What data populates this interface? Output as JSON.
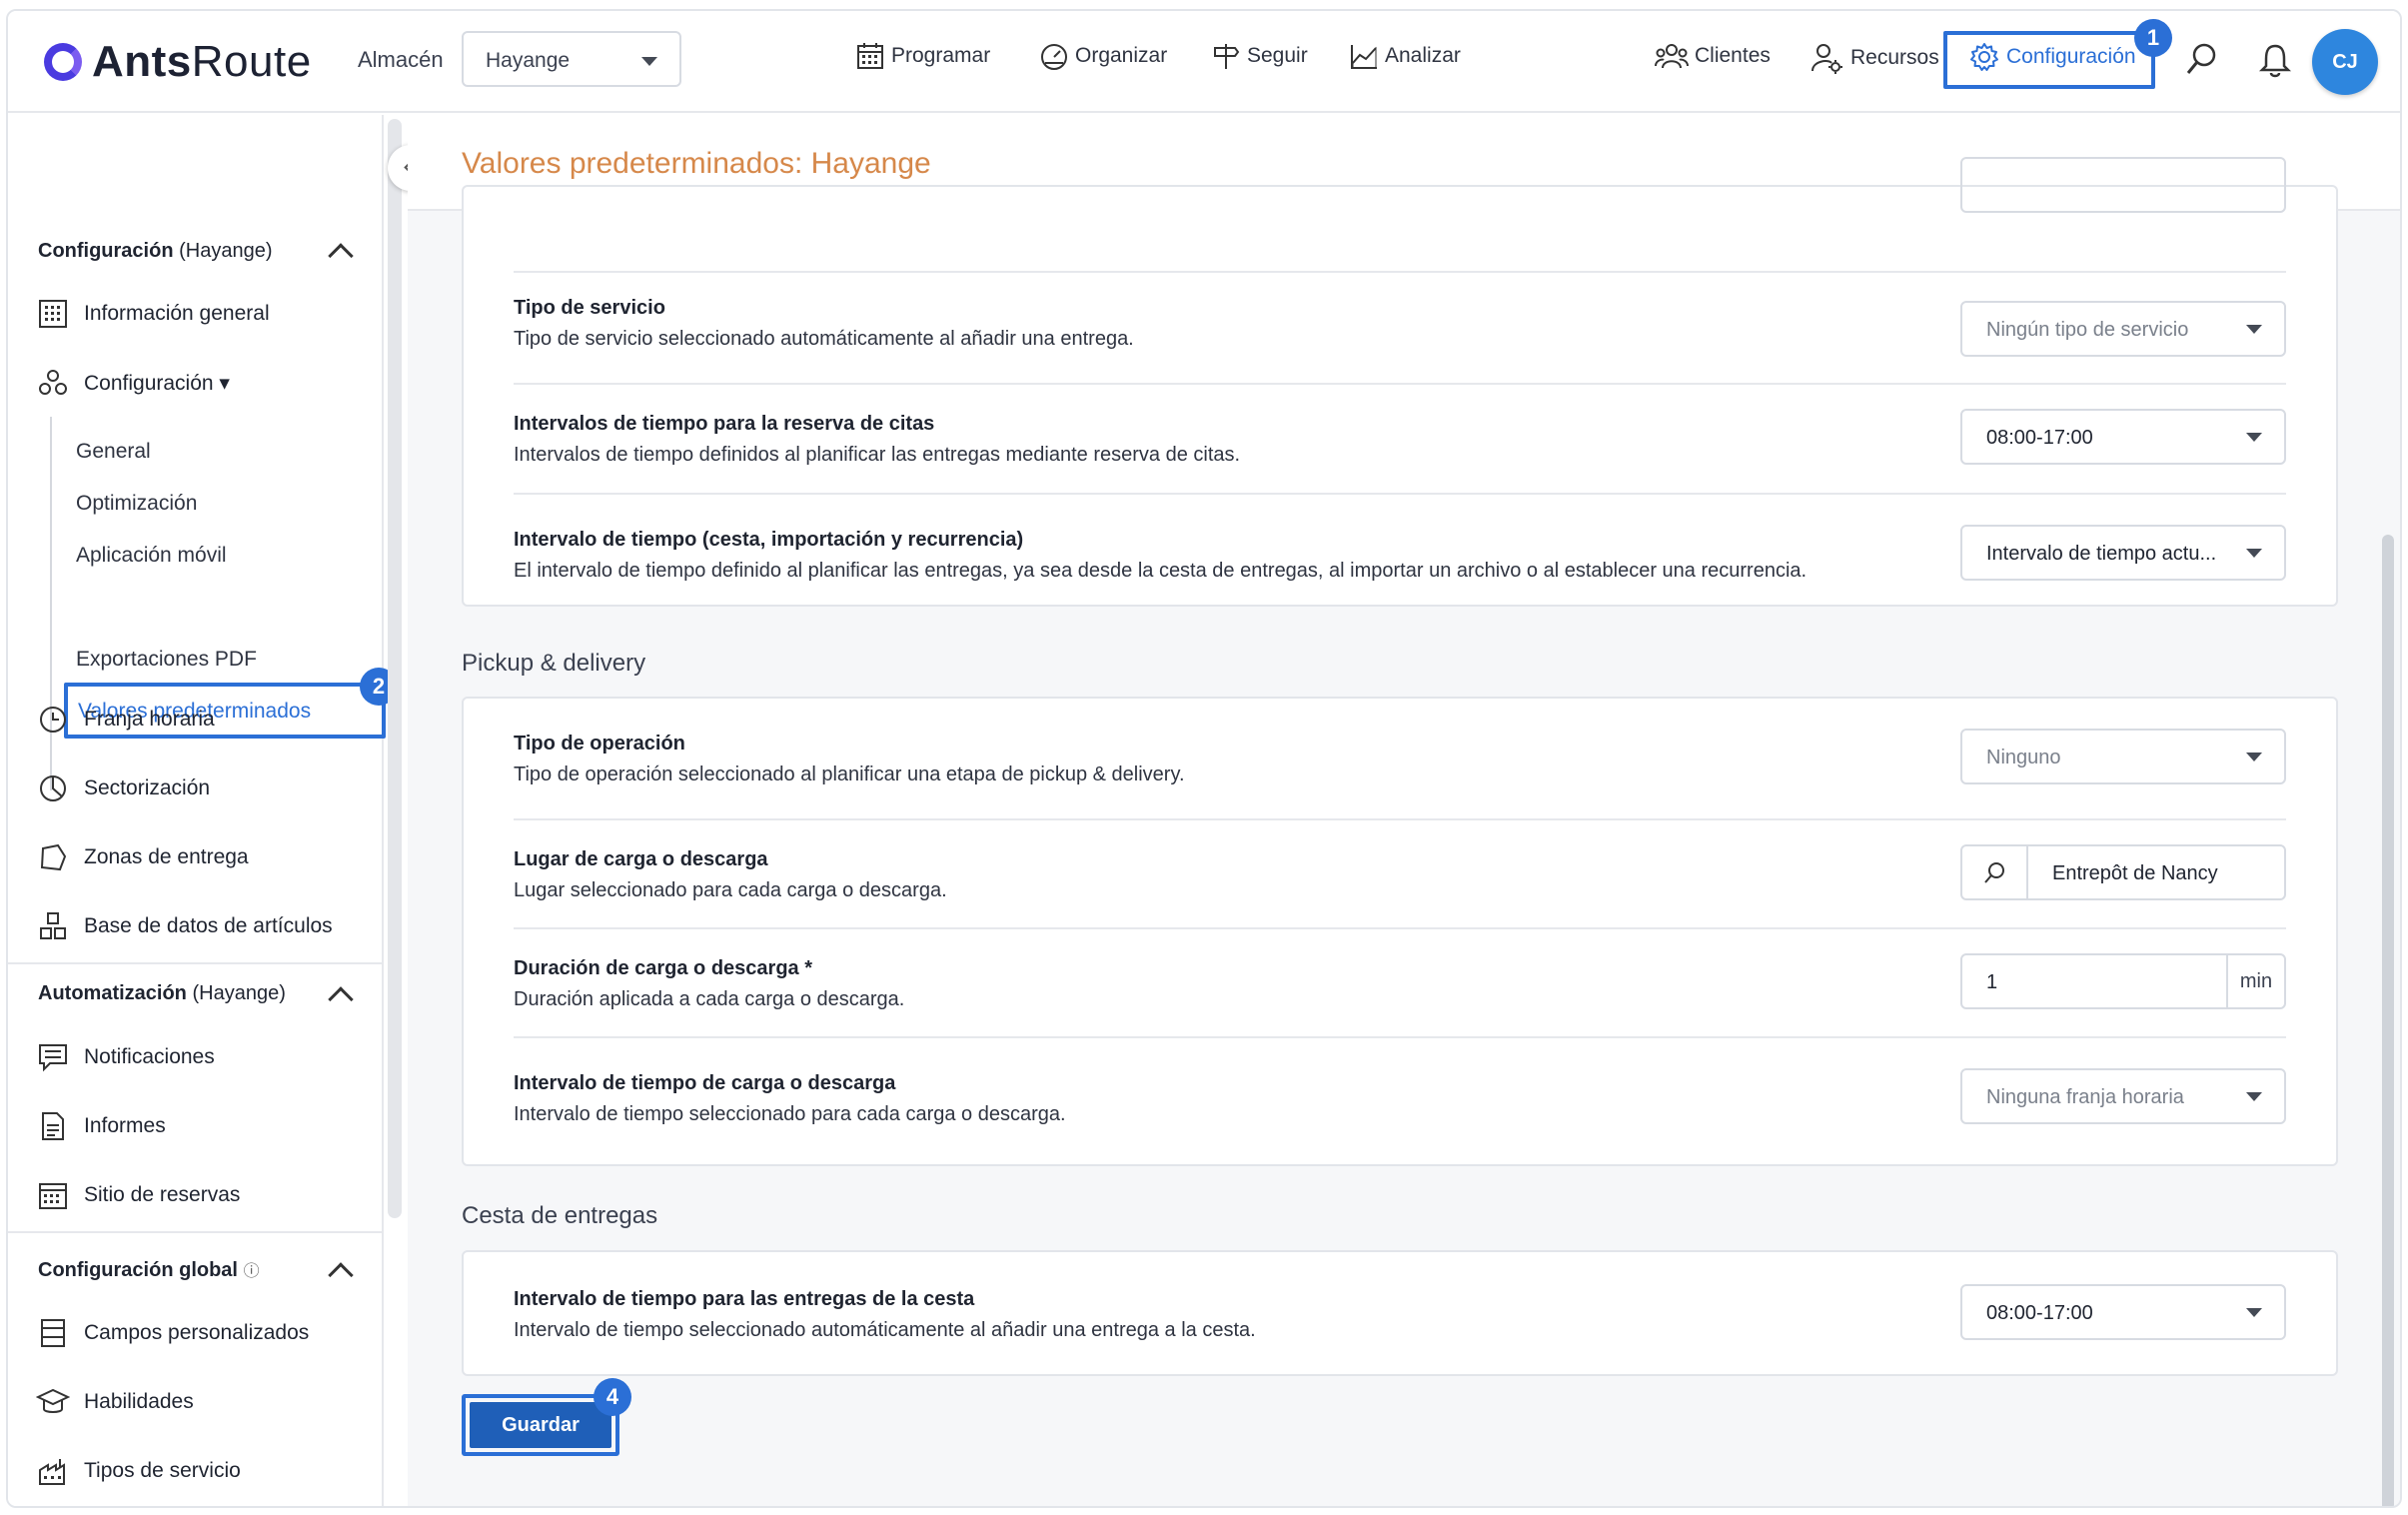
{
  "brand": {
    "name_bold": "Ants",
    "name_light": "Route"
  },
  "warehouse": {
    "label": "Almacén",
    "selected": "Hayange"
  },
  "nav": {
    "programar": "Programar",
    "organizar": "Organizar",
    "seguir": "Seguir",
    "analizar": "Analizar",
    "clientes": "Clientes",
    "recursos": "Recursos",
    "configuracion": "Configuración"
  },
  "user": {
    "initials": "CJ"
  },
  "badges": {
    "b1": "1",
    "b2": "2",
    "b4": "4"
  },
  "sidebar": {
    "config_section": {
      "title": "Configuración",
      "scope": "(Hayange)"
    },
    "info_general": "Información general",
    "configuracion": "Configuración ▾",
    "sub": {
      "general": "General",
      "optimizacion": "Optimización",
      "app_movil": "Aplicación móvil",
      "valores": "Valores predeterminados",
      "exportaciones": "Exportaciones PDF"
    },
    "franja": "Franja horaria",
    "sectorizacion": "Sectorización",
    "zonas": "Zonas de entrega",
    "articulos": "Base de datos de artículos",
    "auto_section": {
      "title": "Automatización",
      "scope": "(Hayange)"
    },
    "notificaciones": "Notificaciones",
    "informes": "Informes",
    "reservas": "Sitio de reservas",
    "global_section": {
      "title": "Configuración global",
      "info": "ⓘ"
    },
    "campos": "Campos personalizados",
    "habilidades": "Habilidades",
    "tipos": "Tipos de servicio"
  },
  "page": {
    "title": "Valores predeterminados: Hayange"
  },
  "defaults": {
    "tipo_servicio": {
      "title": "Tipo de servicio",
      "desc": "Tipo de servicio seleccionado automáticamente al añadir una entrega.",
      "value": "Ningún tipo de servicio"
    },
    "reserva_citas": {
      "title": "Intervalos de tiempo para la reserva de citas",
      "desc": "Intervalos de tiempo definidos al planificar las entregas mediante reserva de citas.",
      "value": "08:00-17:00"
    },
    "intervalo_cesta": {
      "title": "Intervalo de tiempo (cesta, importación y recurrencia)",
      "desc": "El intervalo de tiempo definido al planificar las entregas, ya sea desde la cesta de entregas, al importar un archivo o al establecer una recurrencia.",
      "value": "Intervalo de tiempo actu..."
    }
  },
  "pickup": {
    "section_title": "Pickup & delivery",
    "tipo_operacion": {
      "title": "Tipo de operación",
      "desc": "Tipo de operación seleccionado al planificar una etapa de pickup & delivery.",
      "value": "Ninguno"
    },
    "lugar": {
      "title": "Lugar de carga o descarga",
      "desc": "Lugar seleccionado para cada carga o descarga.",
      "value": "Entrepôt de Nancy"
    },
    "duracion": {
      "title": "Duración de carga o descarga *",
      "desc": "Duración aplicada a cada carga o descarga.",
      "value": "1",
      "unit": "min"
    },
    "intervalo": {
      "title": "Intervalo de tiempo de carga o descarga",
      "desc": "Intervalo de tiempo seleccionado para cada carga o descarga.",
      "value": "Ninguna franja horaria"
    }
  },
  "cesta": {
    "section_title": "Cesta de entregas",
    "intervalo": {
      "title": "Intervalo de tiempo para las entregas de la cesta",
      "desc": "Intervalo de tiempo seleccionado automáticamente al añadir una entrega a la cesta.",
      "value": "08:00-17:00"
    }
  },
  "actions": {
    "save": "Guardar"
  },
  "colors": {
    "accent": "#2b6fd6",
    "title_orange": "#d6884a",
    "save_bg": "#1f5fb8"
  }
}
